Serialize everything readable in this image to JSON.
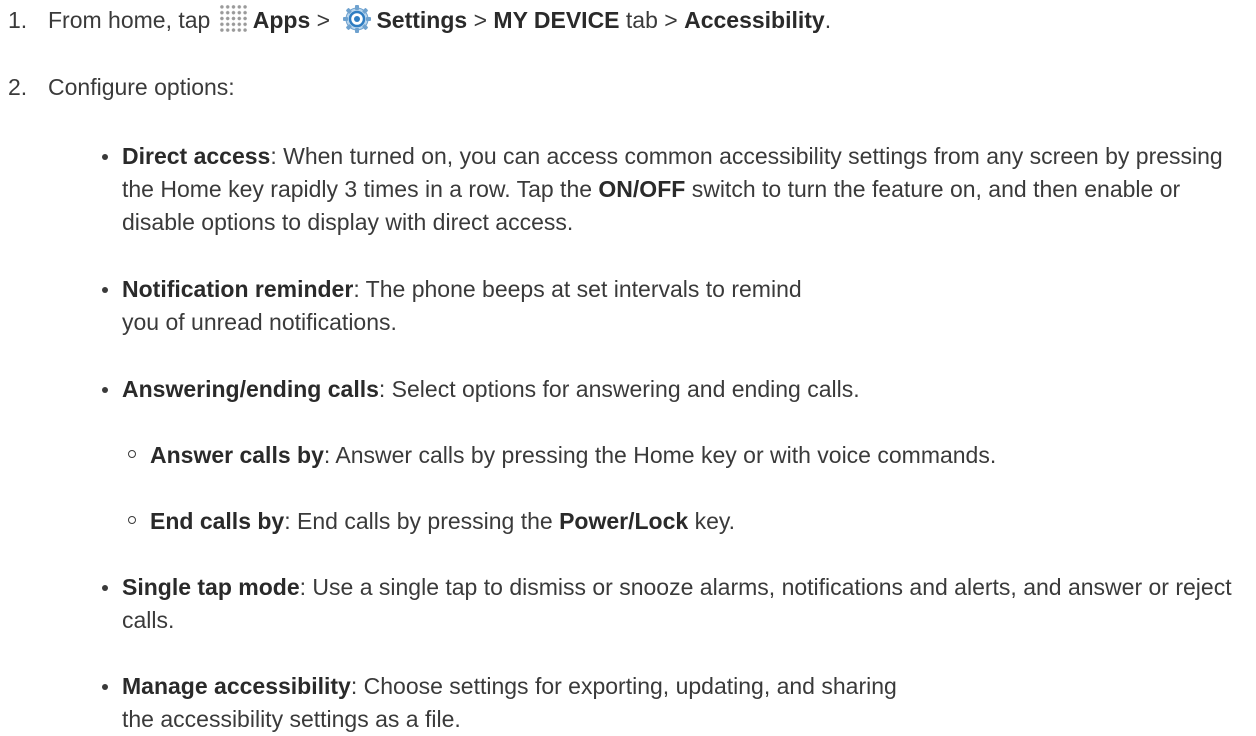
{
  "steps": [
    {
      "number": "1.",
      "prefix": "From home, tap ",
      "apps": "Apps",
      "sep1": " > ",
      "settings": "Settings",
      "sep2": " > ",
      "tab": "MY DEVICE",
      "tab_suffix": " tab > ",
      "target": "Accessibility",
      "end": "."
    },
    {
      "number": "2.",
      "text": "Configure options:"
    }
  ],
  "options": {
    "direct_access": {
      "term": "Direct access",
      "desc1": ": When turned on, you can access common accessibility settings from any screen by pressing the Home key rapidly 3 times in a row. Tap the ",
      "switch": "ON/OFF",
      "desc2": " switch to turn the feature on, and then enable or disable options to display with direct access."
    },
    "notification_reminder": {
      "term": "Notification reminder",
      "desc": ": The phone beeps at set intervals to remind you of unread notifications."
    },
    "answering": {
      "term": "Answering/ending calls",
      "desc": ": Select options for answering and ending calls.",
      "sub": [
        {
          "term": "Answer calls by",
          "desc": ": Answer calls by pressing the Home key or with voice commands."
        },
        {
          "term": "End calls by",
          "desc": ": End calls by pressing the ",
          "key": "Power/Lock",
          "end": " key."
        }
      ]
    },
    "single_tap": {
      "term": "Single tap mode",
      "desc": ": Use a single tap to dismiss or snooze alarms, notifications and alerts, and answer or reject calls."
    },
    "manage": {
      "term": "Manage accessibility",
      "desc": ": Choose settings for exporting, updating, and sharing the accessibility settings as a file."
    }
  },
  "icons": {
    "apps": "apps-grid-icon",
    "settings": "settings-gear-icon"
  }
}
